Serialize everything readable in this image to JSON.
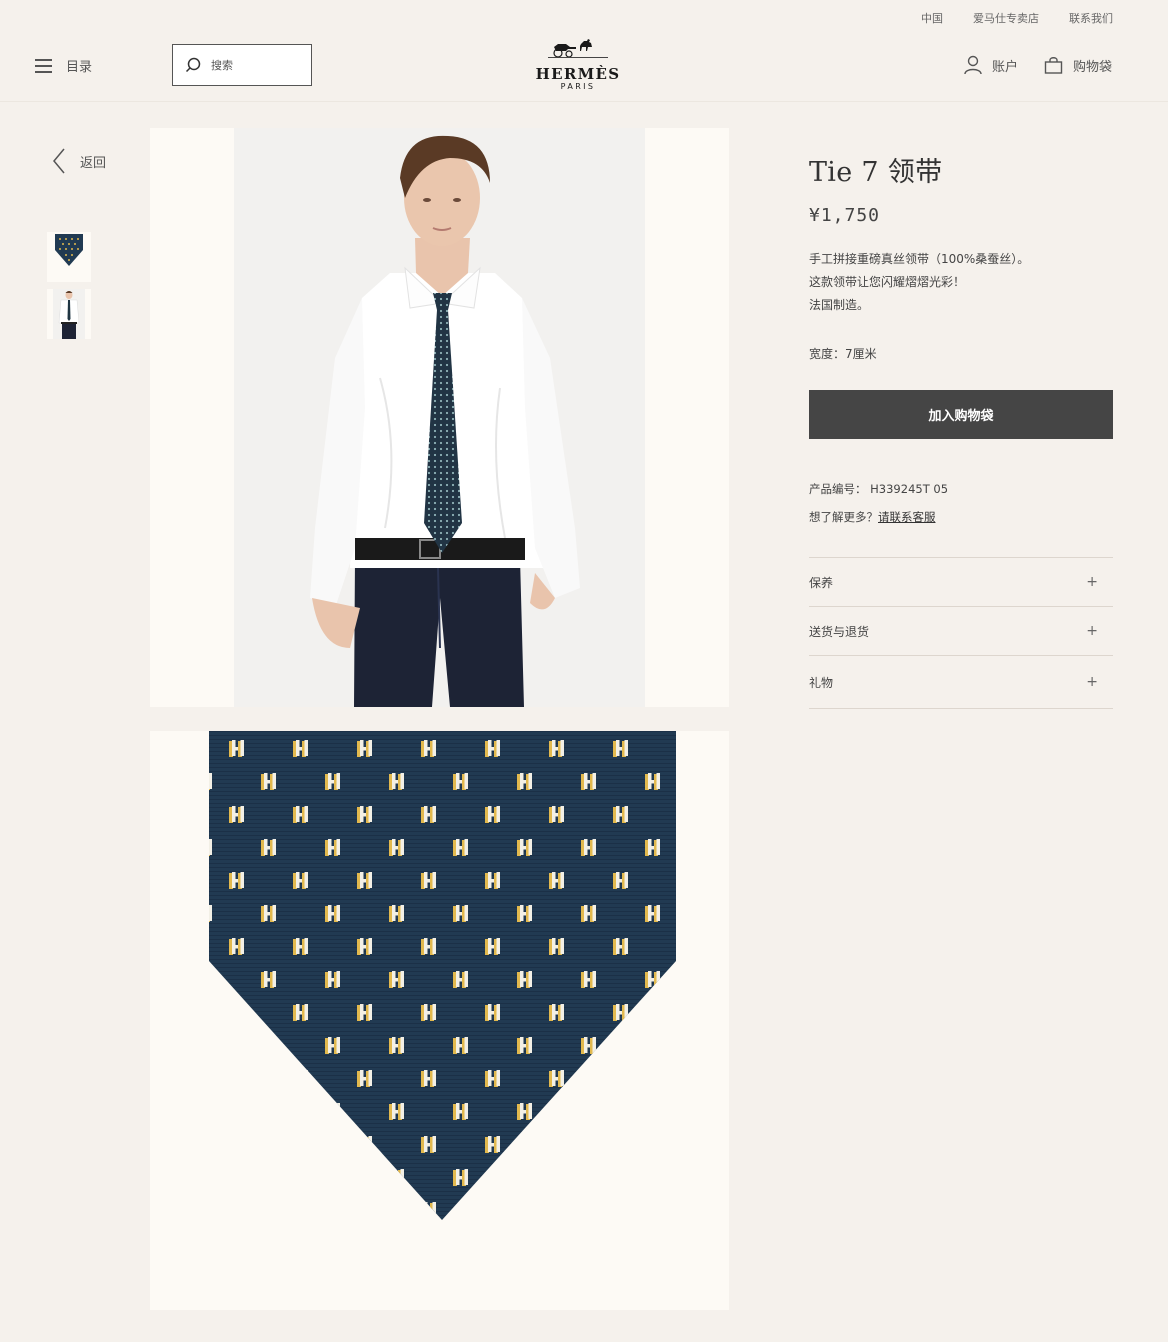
{
  "utility_nav": [
    "中国",
    "爱马仕专卖店",
    "联系我们"
  ],
  "header": {
    "menu_label": "目录",
    "search_placeholder": "搜索",
    "logo_text": "HERMÈS",
    "logo_sub": "PARIS",
    "account_label": "账户",
    "bag_label": "购物袋"
  },
  "nav": {
    "back_label": "返回"
  },
  "product": {
    "title": "Tie 7 领带",
    "price": "¥1,750",
    "description": [
      "手工拼接重磅真丝领带（100%桑蚕丝）。",
      "这款领带让您闪耀熠熠光彩！",
      "法国制造。"
    ],
    "width_text": "宽度：7厘米",
    "add_to_bag": "加入购物袋",
    "sku_text": "产品编号： H339245T 05",
    "more_prefix": "想了解更多？",
    "more_link": "请联系客服"
  },
  "accordion": [
    "保养",
    "送货与退货",
    "礼物"
  ],
  "colors": {
    "background": "#f5f1ec",
    "button": "#454545",
    "tie_navy": "#213a52",
    "tie_dots": "#8fb3b8",
    "pattern_gold": "#e2b94e"
  }
}
